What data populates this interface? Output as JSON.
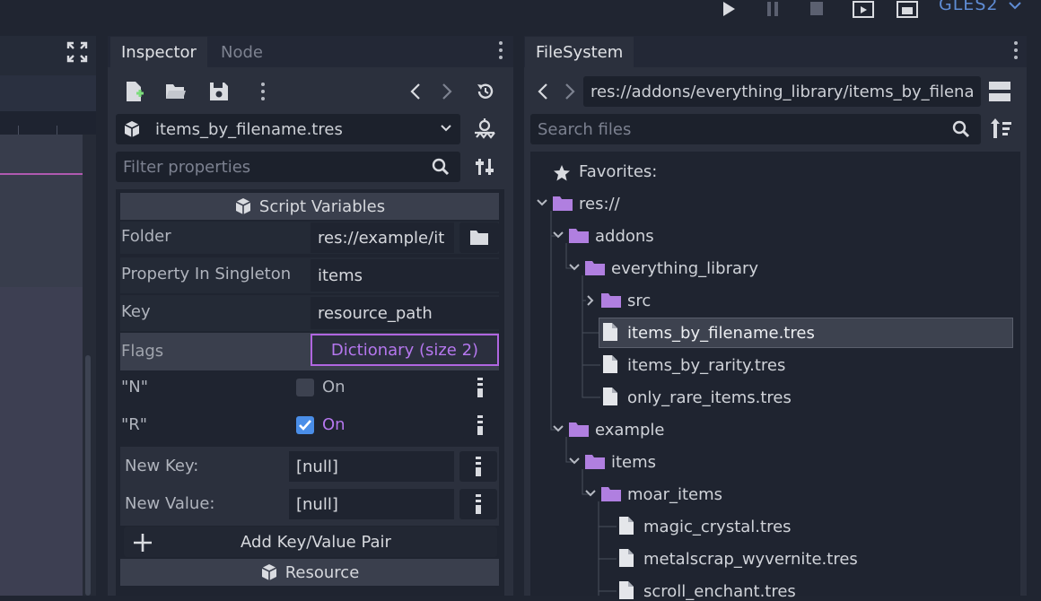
{
  "toolbar": {
    "renderer": "GLES2"
  },
  "inspector": {
    "tabs": [
      "Inspector",
      "Node"
    ],
    "resource_name": "items_by_filename.tres",
    "filter_placeholder": "Filter properties",
    "section_script_variables": "Script Variables",
    "properties": [
      {
        "label": "Folder",
        "value": "res://example/it"
      },
      {
        "label": "Property In Singleton",
        "value": "items"
      },
      {
        "label": "Key",
        "value": "resource_path"
      },
      {
        "label": "Flags",
        "value": "Dictionary (size 2)"
      }
    ],
    "flag_entries": [
      {
        "key": "\"N\"",
        "label": "On",
        "checked": false
      },
      {
        "key": "\"R\"",
        "label": "On",
        "checked": true
      }
    ],
    "new_key_label": "New Key:",
    "new_key_value": "[null]",
    "new_value_label": "New Value:",
    "new_value_value": "[null]",
    "add_pair_label": "Add Key/Value Pair",
    "section_resource": "Resource"
  },
  "filesystem": {
    "tab": "FileSystem",
    "path": "res://addons/everything_library/items_by_filena",
    "search_placeholder": "Search files",
    "favorites": "Favorites:",
    "tree": [
      {
        "label": "res://"
      },
      {
        "label": "addons"
      },
      {
        "label": "everything_library"
      },
      {
        "label": "src"
      },
      {
        "label": "items_by_filename.tres"
      },
      {
        "label": "items_by_rarity.tres"
      },
      {
        "label": "only_rare_items.tres"
      },
      {
        "label": "example"
      },
      {
        "label": "items"
      },
      {
        "label": "moar_items"
      },
      {
        "label": "magic_crystal.tres"
      },
      {
        "label": "metalscrap_wyvernite.tres"
      },
      {
        "label": "scroll_enchant.tres"
      }
    ]
  },
  "colors": {
    "accent": "#5f8cd4",
    "folder": "#b07fe0",
    "flags_highlight": "#b066e0",
    "checkbox_checked": "#4a8ee8"
  }
}
